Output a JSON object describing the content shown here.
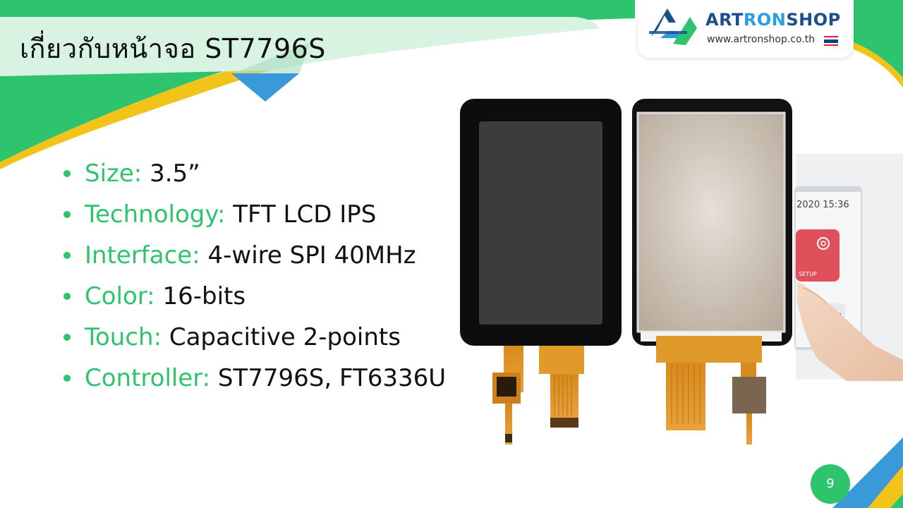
{
  "slide": {
    "title": "เกี่ยวกับหน้าจอ ST7796S",
    "page_number": "9"
  },
  "logo": {
    "name_part1": "ART",
    "name_part2": "RON",
    "name_part3": "SHOP",
    "url": "www.artronshop.co.th"
  },
  "specs": [
    {
      "label": "Size:",
      "value": "3.5”"
    },
    {
      "label": "Technology:",
      "value": "TFT LCD IPS"
    },
    {
      "label": "Interface:",
      "value": "4-wire SPI 40MHz"
    },
    {
      "label": "Color:",
      "value": "16-bits"
    },
    {
      "label": "Touch:",
      "value": "Capacitive 2-points"
    },
    {
      "label": "Controller:",
      "value": "ST7796S, FT6336U"
    }
  ],
  "device_ui": {
    "time_text": "2020 15:36",
    "setup_label": "SETUP"
  },
  "colors": {
    "accent_green": "#2ec46e",
    "accent_blue": "#3a9ad9",
    "accent_yellow": "#f2c318",
    "logo_dark_blue": "#1b4f8a",
    "logo_light_blue": "#2a9de0"
  },
  "icons": [
    "artronshop-logo-icon",
    "thai-flag-icon",
    "gear-icon"
  ]
}
